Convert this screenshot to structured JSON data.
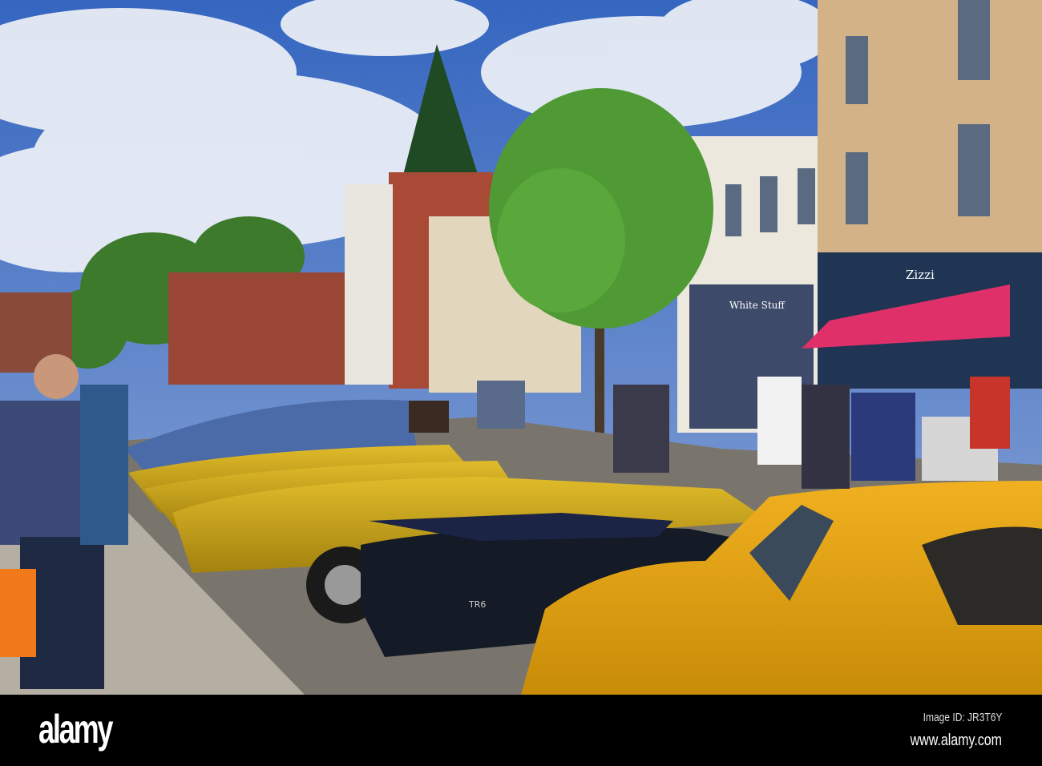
{
  "photo": {
    "signs": {
      "restaurant": "Zizzi",
      "shop": "White Stuff",
      "car_badge": "TR6"
    }
  },
  "watermark": {
    "logo": "alamy",
    "image_id": "Image ID: JR3T6Y",
    "site": "www.alamy.com"
  },
  "colors": {
    "sky": "#3f6fc4",
    "car_yellow": "#c9a41c",
    "awning": "#e0306a",
    "bar": "#000000"
  }
}
